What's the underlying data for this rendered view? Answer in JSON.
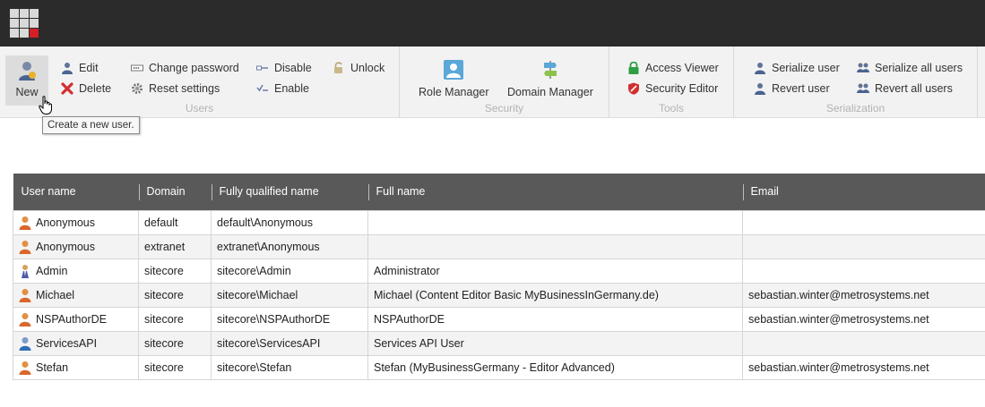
{
  "ribbon": {
    "users_group": {
      "label": "Users",
      "new_label": "New",
      "edit_label": "Edit",
      "delete_label": "Delete",
      "change_password_label": "Change password",
      "reset_settings_label": "Reset settings",
      "disable_label": "Disable",
      "enable_label": "Enable",
      "unlock_label": "Unlock"
    },
    "security_group": {
      "label": "Security",
      "role_manager_label": "Role Manager",
      "domain_manager_label": "Domain Manager"
    },
    "tools_group": {
      "label": "Tools",
      "access_viewer_label": "Access Viewer",
      "security_editor_label": "Security Editor"
    },
    "serialization_group": {
      "label": "Serialization",
      "serialize_user_label": "Serialize user",
      "revert_user_label": "Revert user",
      "serialize_all_label": "Serialize all users",
      "revert_all_label": "Revert all users"
    }
  },
  "tooltip": {
    "text": "Create a new user."
  },
  "grid": {
    "columns": [
      "User name",
      "Domain",
      "Fully qualified name",
      "Full name",
      "Email"
    ],
    "rows": [
      {
        "icon": "user-orange-icon",
        "user": "Anonymous",
        "domain": "default",
        "fqn": "default\\Anonymous",
        "full_name": "",
        "email": ""
      },
      {
        "icon": "user-orange-icon",
        "user": "Anonymous",
        "domain": "extranet",
        "fqn": "extranet\\Anonymous",
        "full_name": "",
        "email": ""
      },
      {
        "icon": "admin-user-icon",
        "user": "Admin",
        "domain": "sitecore",
        "fqn": "sitecore\\Admin",
        "full_name": "Administrator",
        "email": ""
      },
      {
        "icon": "user-orange-icon",
        "user": "Michael",
        "domain": "sitecore",
        "fqn": "sitecore\\Michael",
        "full_name": "Michael (Content Editor Basic MyBusinessInGermany.de)",
        "email": "sebastian.winter@metrosystems.net"
      },
      {
        "icon": "user-orange-icon",
        "user": "NSPAuthorDE",
        "domain": "sitecore",
        "fqn": "sitecore\\NSPAuthorDE",
        "full_name": "NSPAuthorDE",
        "email": "sebastian.winter@metrosystems.net"
      },
      {
        "icon": "user-blue-icon",
        "user": "ServicesAPI",
        "domain": "sitecore",
        "fqn": "sitecore\\ServicesAPI",
        "full_name": "Services API User",
        "email": ""
      },
      {
        "icon": "user-orange-icon",
        "user": "Stefan",
        "domain": "sitecore",
        "fqn": "sitecore\\Stefan",
        "full_name": "Stefan (MyBusinessGermany - Editor Advanced)",
        "email": "sebastian.winter@metrosystems.net"
      }
    ]
  },
  "colors": {
    "topbar": "#2b2b2b",
    "ribbon_bg": "#f2f2f2",
    "grid_header": "#595959",
    "logo_accent": "#d41f26"
  }
}
